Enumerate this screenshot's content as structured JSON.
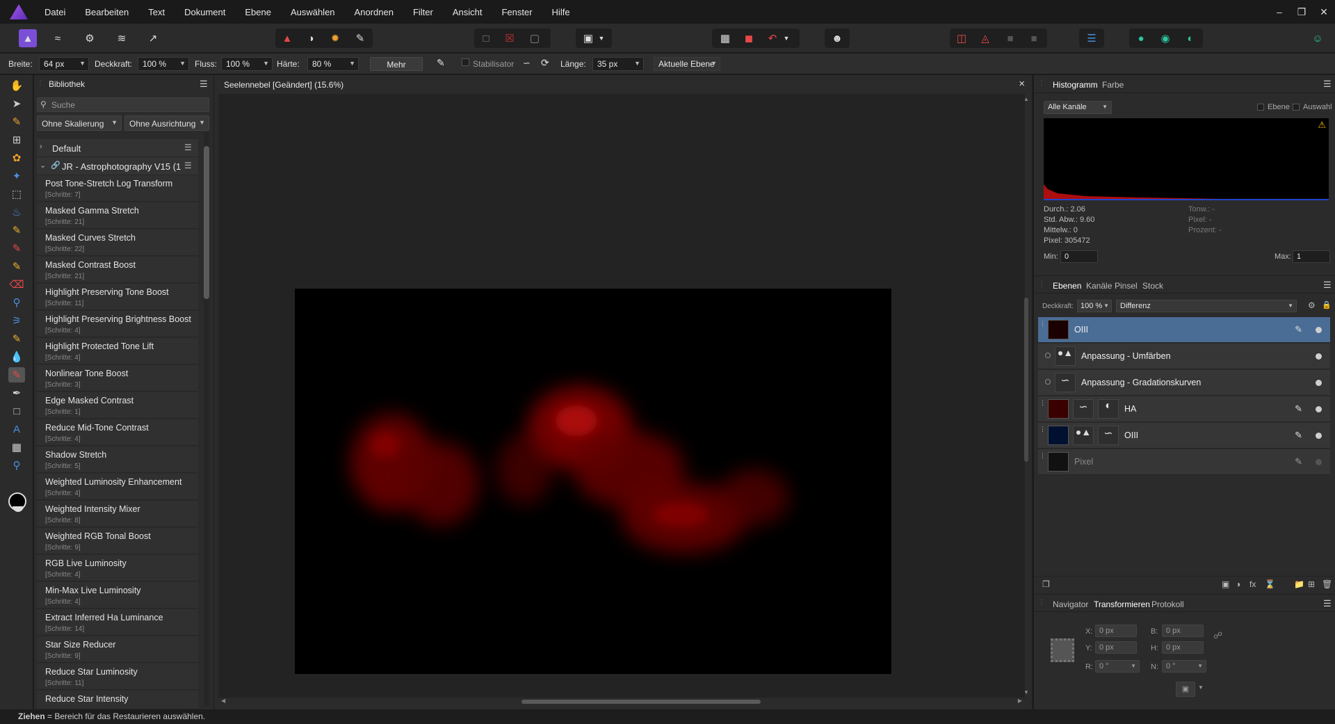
{
  "menu": [
    "Datei",
    "Bearbeiten",
    "Text",
    "Dokument",
    "Ebene",
    "Auswählen",
    "Anordnen",
    "Filter",
    "Ansicht",
    "Fenster",
    "Hilfe"
  ],
  "context_bar": {
    "width_label": "Breite:",
    "width_value": "64 px",
    "opacity_label": "Deckkraft:",
    "opacity_value": "100 %",
    "flow_label": "Fluss:",
    "flow_value": "100 %",
    "hardness_label": "Härte:",
    "hardness_value": "80 %",
    "more_button": "Mehr",
    "stabilizer_label": "Stabilisator",
    "length_label": "Länge:",
    "length_value": "35 px",
    "source_value": "Aktuelle Ebene"
  },
  "library": {
    "title": "Bibliothek",
    "search_placeholder": "Suche",
    "scale_select": "Ohne Skalierung",
    "align_select": "Ohne Ausrichtung",
    "categories": [
      "Default",
      "JR - Astrophotography V15 (1"
    ],
    "macros": [
      {
        "name": "Post Tone-Stretch Log Transform",
        "steps": "[Schritte: 7]"
      },
      {
        "name": "Masked Gamma Stretch",
        "steps": "[Schritte: 21]"
      },
      {
        "name": "Masked Curves Stretch",
        "steps": "[Schritte: 22]"
      },
      {
        "name": "Masked Contrast Boost",
        "steps": "[Schritte: 21]"
      },
      {
        "name": "Highlight Preserving Tone Boost",
        "steps": "[Schritte: 11]"
      },
      {
        "name": "Highlight Preserving Brightness Boost",
        "steps": "[Schritte: 4]"
      },
      {
        "name": "Highlight Protected Tone Lift",
        "steps": "[Schritte: 4]"
      },
      {
        "name": "Nonlinear Tone Boost",
        "steps": "[Schritte: 3]"
      },
      {
        "name": "Edge Masked Contrast",
        "steps": "[Schritte: 1]"
      },
      {
        "name": "Reduce Mid-Tone Contrast",
        "steps": "[Schritte: 4]"
      },
      {
        "name": "Shadow Stretch",
        "steps": "[Schritte: 5]"
      },
      {
        "name": "Weighted Luminosity Enhancement",
        "steps": "[Schritte: 4]"
      },
      {
        "name": "Weighted Intensity Mixer",
        "steps": "[Schritte: 8]"
      },
      {
        "name": "Weighted RGB Tonal Boost",
        "steps": "[Schritte: 9]"
      },
      {
        "name": "RGB Live Luminosity",
        "steps": "[Schritte: 4]"
      },
      {
        "name": "Min-Max Live Luminosity",
        "steps": "[Schritte: 4]"
      },
      {
        "name": "Extract Inferred Ha Luminance",
        "steps": "[Schritte: 14]"
      },
      {
        "name": "Star Size Reducer",
        "steps": "[Schritte: 9]"
      },
      {
        "name": "Reduce Star Luminosity",
        "steps": "[Schritte: 11]"
      },
      {
        "name": "Reduce Star Intensity",
        "steps": ""
      }
    ]
  },
  "document": {
    "tab_title": "Seelennebel [Geändert] (15.6%)",
    "close": "×"
  },
  "histogram": {
    "tabs": [
      "Histogramm",
      "Farbe"
    ],
    "channel_select": "Alle Kanäle",
    "layer_check": "Ebene",
    "selection_check": "Auswahl",
    "stats_left": [
      "Durch.: 2.06",
      "Std. Abw.: 9.60",
      "Mittelw.: 0",
      "Pixel: 305472"
    ],
    "stats_right": [
      "Tonw.: -",
      "Pixel: -",
      "Prozent: -"
    ],
    "min_label": "Min:",
    "min_value": "0",
    "max_label": "Max:",
    "max_value": "1",
    "warning_color": "#f2c200"
  },
  "layers": {
    "tabs": [
      "Ebenen",
      "Kanäle",
      "Pinsel",
      "Stock"
    ],
    "opacity_label": "Deckkraft:",
    "opacity_value": "100 %",
    "blend_mode": "Differenz",
    "items": [
      {
        "name": "OIII"
      },
      {
        "name": "Anpassung - Umfärben"
      },
      {
        "name": "Anpassung - Gradationskurven"
      },
      {
        "name": "HA"
      },
      {
        "name": "OIII"
      },
      {
        "name": "Pixel"
      }
    ],
    "selected_color": "#4a6d96"
  },
  "transform": {
    "tabs": [
      "Navigator",
      "Transformieren",
      "Protokoll"
    ],
    "x_label": "X:",
    "x_value": "0 px",
    "y_label": "Y:",
    "y_value": "0 px",
    "b_label": "B:",
    "b_value": "0 px",
    "h_label": "H:",
    "h_value": "0 px",
    "r_label": "R:",
    "r_value": "0 °",
    "n_label": "N:",
    "n_value": "0 °"
  },
  "status": {
    "bold": "Ziehen",
    "text": " = Bereich für das Restaurieren auswählen."
  }
}
